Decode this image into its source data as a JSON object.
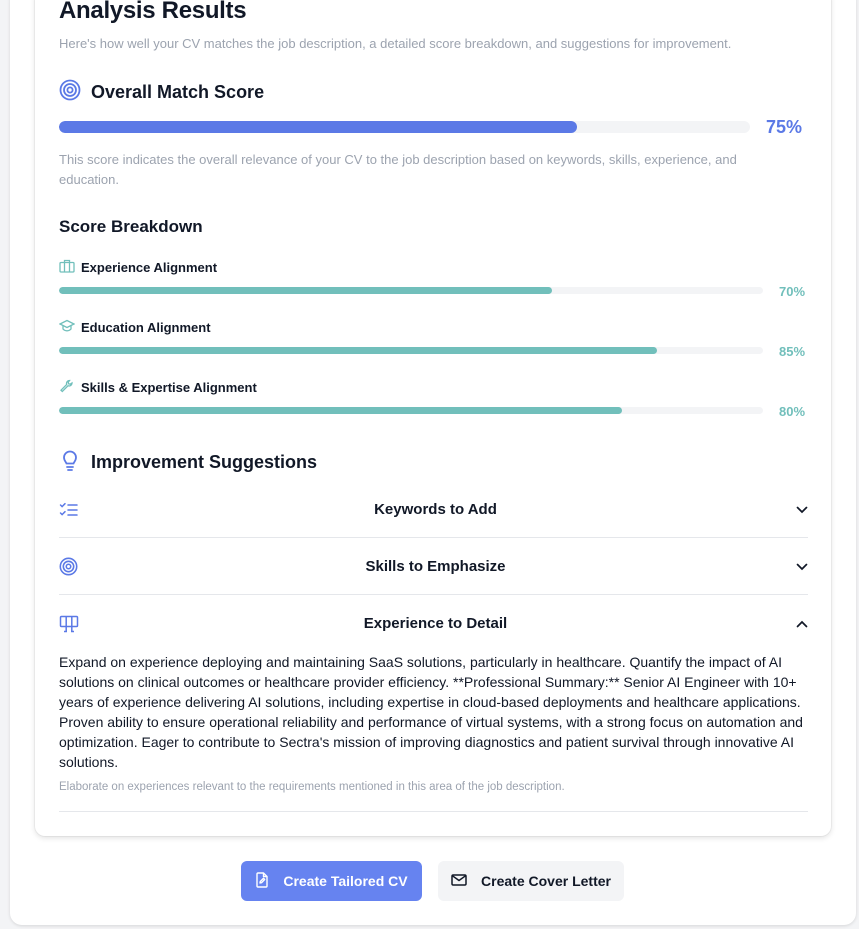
{
  "header": {
    "title": "Analysis Results",
    "subtitle": "Here's how well your CV matches the job description, a detailed score breakdown, and suggestions for improvement."
  },
  "overall": {
    "heading": "Overall Match Score",
    "score": 75,
    "score_label": "75%",
    "description": "This score indicates the overall relevance of your CV to the job description based on keywords, skills, experience, and education.",
    "icon": "target-icon",
    "color": "#5b79e6"
  },
  "breakdown": {
    "heading": "Score Breakdown",
    "color": "#71bfbb",
    "items": [
      {
        "label": "Experience Alignment",
        "value": 70,
        "pct_label": "70%",
        "icon": "briefcase-icon"
      },
      {
        "label": "Education Alignment",
        "value": 85,
        "pct_label": "85%",
        "icon": "graduation-cap-icon"
      },
      {
        "label": "Skills & Expertise Alignment",
        "value": 80,
        "pct_label": "80%",
        "icon": "wrench-icon"
      }
    ]
  },
  "suggestions": {
    "heading": "Improvement Suggestions",
    "icon": "lightbulb-icon",
    "items": [
      {
        "title": "Keywords to Add",
        "icon": "list-checks-icon",
        "expanded": false
      },
      {
        "title": "Skills to Emphasize",
        "icon": "target-icon",
        "expanded": false
      },
      {
        "title": "Experience to Detail",
        "icon": "columns-icon",
        "expanded": true
      }
    ],
    "expanded_body": "Expand on experience deploying and maintaining SaaS solutions, particularly in healthcare. Quantify the impact of AI solutions on clinical outcomes or healthcare provider efficiency. **Professional Summary:** Senior AI Engineer with 10+ years of experience delivering AI solutions, including expertise in cloud-based deployments and healthcare applications. Proven ability to ensure operational reliability and performance of virtual systems, with a strong focus on automation and optimization. Eager to contribute to Sectra's mission of improving diagnostics and patient survival through innovative AI solutions.",
    "expanded_note": "Elaborate on experiences relevant to the requirements mentioned in this area of the job description."
  },
  "actions": {
    "primary_label": "Create Tailored CV",
    "secondary_label": "Create Cover Letter",
    "primary_color": "#6683f0"
  }
}
